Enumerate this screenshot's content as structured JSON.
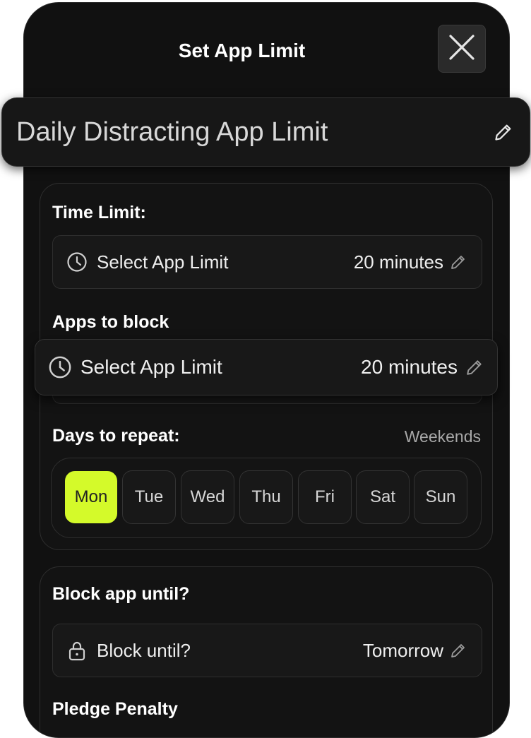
{
  "header": {
    "title": "Set App Limit"
  },
  "limit_name": "Daily Distracting App Limit",
  "time_limit": {
    "label": "Time Limit:",
    "row_label": "Select App Limit",
    "value": "20 minutes"
  },
  "apps_to_block": {
    "label": "Apps to block",
    "row_label": "Select App Limit",
    "value": "20 minutes"
  },
  "days_to_repeat": {
    "label": "Days to repeat:",
    "mode": "Weekends",
    "days": [
      {
        "label": "Mon",
        "selected": true
      },
      {
        "label": "Tue",
        "selected": false
      },
      {
        "label": "Wed",
        "selected": false
      },
      {
        "label": "Thu",
        "selected": false
      },
      {
        "label": "Fri",
        "selected": false
      },
      {
        "label": "Sat",
        "selected": false
      },
      {
        "label": "Sun",
        "selected": false
      }
    ]
  },
  "block_until": {
    "label": "Block app until?",
    "row_label": "Block until?",
    "value": "Tomorrow"
  },
  "pledge": {
    "label": "Pledge Penalty"
  },
  "colors": {
    "accent": "#d4fa2a",
    "background": "#111111"
  }
}
